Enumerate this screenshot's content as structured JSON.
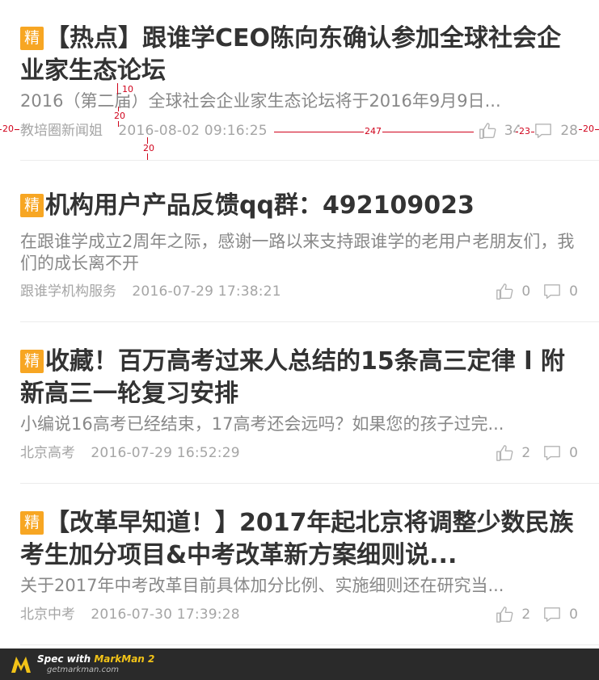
{
  "articles": [
    {
      "badge": "精",
      "title": "【热点】跟谁学CEO陈向东确认参加全球社会企业家生态论坛",
      "summary": "2016（第二届）全球社会企业家生态论坛将于2016年9月9日...",
      "author": "教培圈新闻姐",
      "time": "2016-08-02 09:16:25",
      "likes": "34",
      "comments": "28"
    },
    {
      "badge": "精",
      "title": "机构用户产品反馈qq群：492109023",
      "summary": "在跟谁学成立2周年之际，感谢一路以来支持跟谁学的老用户老朋友们，我们的成长离不开",
      "author": "跟谁学机构服务",
      "time": "2016-07-29 17:38:21",
      "likes": "0",
      "comments": "0"
    },
    {
      "badge": "精",
      "title": "收藏！百万高考过来人总结的15条高三定律 l 附新高三一轮复习安排",
      "summary": "小编说16高考已经结束，17高考还会远吗？如果您的孩子过完...",
      "author": "北京高考",
      "time": "2016-07-29 16:52:29",
      "likes": "2",
      "comments": "0"
    },
    {
      "badge": "精",
      "title": "【改革早知道！】2017年起北京将调整少数民族考生加分项目&中考改革新方案细则说...",
      "summary": "关于2017年中考改革目前具体加分比例、实施细则还在研究当...",
      "author": "北京中考",
      "time": "2016-07-30 17:39:28",
      "likes": "2",
      "comments": "0"
    }
  ],
  "annotations": {
    "m10": "10",
    "m20a": "20",
    "m20b": "20",
    "m247": "247",
    "m23": "23",
    "m20left": "20",
    "m20right": "20"
  },
  "footer": {
    "prefix": "Spec with ",
    "brand": "MarkMan 2",
    "url": "getmarkman.com"
  },
  "colors": {
    "badge": "#f7a623",
    "annotation": "#d0021b",
    "footer_bg": "#2a2a2a"
  }
}
